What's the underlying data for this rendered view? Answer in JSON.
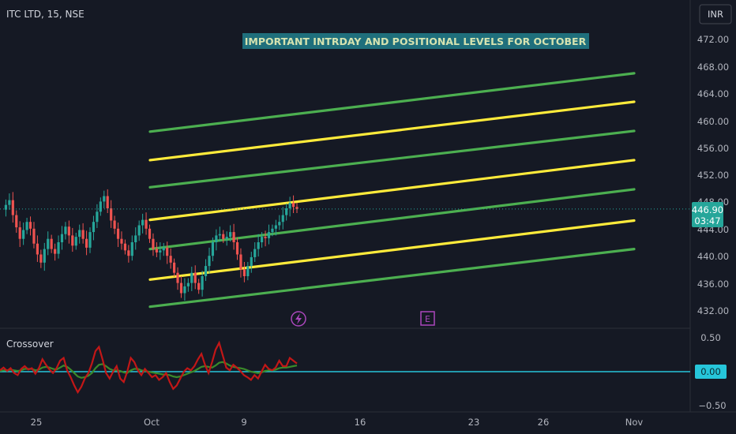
{
  "symbol_title": "ITC LTD, 15, NSE",
  "currency_button": "INR",
  "annotation": "IMPORTANT INTRDAY AND POSITIONAL LEVELS FOR OCTOBER",
  "indicator_name": "Crossover",
  "current_price": {
    "value": "446.90",
    "countdown": "03:47"
  },
  "price_axis_labels": [
    "472.00",
    "468.00",
    "464.00",
    "460.00",
    "456.00",
    "452.00",
    "448.00",
    "444.00",
    "440.00",
    "436.00",
    "432.00"
  ],
  "indicator_axis": {
    "top": "0.50",
    "zero": "0.00",
    "bottom": "−0.50"
  },
  "time_axis_labels": [
    "25",
    "Oct",
    "9",
    "16",
    "23",
    "26",
    "Nov"
  ],
  "event_markers": {
    "dividend_icon": "lightning",
    "earnings_label": "E"
  },
  "colors": {
    "background": "#151924",
    "green_level": "#4caf50",
    "yellow_level": "#ffeb3b",
    "up_candle": "#26a69a",
    "down_candle": "#ef5350",
    "indicator_red": "#c21717",
    "indicator_green": "#3a8a2a",
    "zero_line": "#26c6da",
    "annotation_bg": "#1f6f7c",
    "annotation_text": "#d6e3b0"
  },
  "chart_data": {
    "type": "line",
    "price_scale": {
      "ylim": [
        430.5,
        475.0
      ]
    },
    "level_lines": [
      {
        "color": "green",
        "from": {
          "date": "Oct 1",
          "price": 458.3
        },
        "to": {
          "date": "Nov 1",
          "price": 466.9
        }
      },
      {
        "color": "yellow",
        "from": {
          "date": "Oct 1",
          "price": 454.1
        },
        "to": {
          "date": "Nov 1",
          "price": 462.7
        }
      },
      {
        "color": "green",
        "from": {
          "date": "Oct 1",
          "price": 450.1
        },
        "to": {
          "date": "Nov 1",
          "price": 458.4
        }
      },
      {
        "color": "yellow",
        "from": {
          "date": "Oct 1",
          "price": 445.3
        },
        "to": {
          "date": "Nov 1",
          "price": 454.1
        }
      },
      {
        "color": "green",
        "from": {
          "date": "Oct 1",
          "price": 441.0
        },
        "to": {
          "date": "Nov 1",
          "price": 449.8
        }
      },
      {
        "color": "yellow",
        "from": {
          "date": "Oct 1",
          "price": 436.5
        },
        "to": {
          "date": "Nov 1",
          "price": 445.2
        }
      },
      {
        "color": "green",
        "from": {
          "date": "Oct 1",
          "price": 432.5
        },
        "to": {
          "date": "Nov 1",
          "price": 441.0
        }
      }
    ],
    "price_series": [
      446.8,
      447.5,
      448.2,
      446.0,
      444.2,
      442.5,
      443.8,
      445.0,
      444.0,
      441.8,
      440.2,
      439.0,
      441.0,
      442.5,
      441.0,
      440.3,
      442.0,
      443.2,
      444.3,
      443.0,
      441.5,
      442.8,
      443.8,
      442.5,
      441.2,
      443.5,
      445.0,
      446.5,
      448.0,
      448.8,
      447.0,
      445.2,
      444.0,
      442.5,
      441.8,
      440.8,
      440.0,
      442.0,
      443.0,
      444.5,
      445.3,
      444.0,
      442.5,
      441.0,
      440.5,
      440.8,
      441.2,
      440.0,
      439.0,
      437.5,
      436.0,
      434.5,
      435.5,
      436.0,
      437.5,
      436.0,
      435.0,
      437.0,
      438.5,
      440.0,
      442.0,
      443.0,
      443.2,
      442.5,
      442.8,
      443.5,
      442.0,
      440.2,
      438.0,
      437.0,
      438.5,
      439.8,
      441.0,
      442.0,
      442.8,
      442.6,
      443.5,
      444.0,
      444.5,
      445.0,
      446.0,
      447.0,
      447.8,
      447.2,
      446.9
    ],
    "indicator": {
      "ylim": [
        -0.62,
        0.62
      ],
      "red_series": [
        0.02,
        0.06,
        0.01,
        0.05,
        -0.02,
        -0.05,
        0.04,
        0.08,
        0.03,
        0.05,
        -0.03,
        0.05,
        0.18,
        0.1,
        0.03,
        -0.02,
        0.05,
        0.16,
        0.2,
        0.02,
        -0.08,
        -0.2,
        -0.3,
        -0.22,
        -0.1,
        -0.02,
        0.12,
        0.3,
        0.36,
        0.18,
        -0.02,
        -0.1,
        0.0,
        0.08,
        -0.1,
        -0.15,
        0.0,
        0.2,
        0.14,
        0.02,
        -0.05,
        0.04,
        -0.02,
        -0.08,
        -0.05,
        -0.12,
        -0.08,
        -0.02,
        -0.15,
        -0.25,
        -0.2,
        -0.1,
        0.0,
        0.05,
        0.02,
        0.08,
        0.18,
        0.26,
        0.1,
        -0.02,
        0.14,
        0.32,
        0.42,
        0.24,
        0.06,
        0.02,
        0.1,
        0.06,
        0.01,
        -0.05,
        -0.08,
        -0.12,
        -0.05,
        -0.1,
        0.0,
        0.1,
        0.04,
        0.02,
        0.06,
        0.16,
        0.08,
        0.08,
        0.2,
        0.16,
        0.12
      ],
      "green_series": [
        0.01,
        0.02,
        0.02,
        0.03,
        0.02,
        0.01,
        0.02,
        0.04,
        0.04,
        0.04,
        0.02,
        0.03,
        0.06,
        0.07,
        0.06,
        0.04,
        0.03,
        0.06,
        0.09,
        0.07,
        0.03,
        -0.02,
        -0.07,
        -0.09,
        -0.08,
        -0.06,
        -0.02,
        0.05,
        0.1,
        0.11,
        0.08,
        0.04,
        0.02,
        0.02,
        0.01,
        -0.01,
        -0.02,
        0.02,
        0.04,
        0.04,
        0.02,
        0.01,
        0.0,
        -0.01,
        -0.02,
        -0.03,
        -0.04,
        -0.04,
        -0.05,
        -0.07,
        -0.08,
        -0.07,
        -0.05,
        -0.03,
        -0.01,
        0.01,
        0.04,
        0.07,
        0.08,
        0.07,
        0.06,
        0.09,
        0.13,
        0.14,
        0.12,
        0.09,
        0.07,
        0.06,
        0.05,
        0.04,
        0.02,
        0.0,
        -0.01,
        -0.02,
        -0.01,
        0.01,
        0.02,
        0.02,
        0.03,
        0.05,
        0.06,
        0.06,
        0.07,
        0.08,
        0.09
      ]
    }
  }
}
